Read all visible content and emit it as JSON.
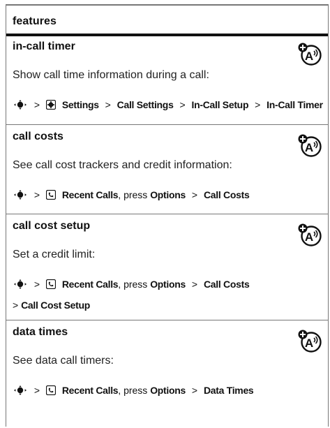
{
  "header": {
    "label": "features"
  },
  "common": {
    "arrow": ">"
  },
  "sections": [
    {
      "title": "in-call timer",
      "description": "Show call time information during a call:",
      "path": {
        "menu": "Settings",
        "step1": "Call Settings",
        "step2": "In-Call Setup",
        "step3": "In-Call Timer"
      }
    },
    {
      "title": "call costs",
      "description": "See call cost trackers and credit information:",
      "path": {
        "menu": "Recent Calls",
        "press": ", press",
        "option": "Options",
        "item": "Call Costs"
      }
    },
    {
      "title": "call cost setup",
      "description": "Set a credit limit:",
      "path": {
        "menu": "Recent Calls",
        "press": ", press",
        "option": "Options",
        "item": "Call Costs",
        "item2": "Call Cost Setup"
      }
    },
    {
      "title": "data times",
      "description": "See data call timers:",
      "path": {
        "menu": "Recent Calls",
        "press": ", press",
        "option": "Options",
        "item": "Data Times"
      }
    }
  ],
  "icons": {
    "network": "network-dependent-feature-icon",
    "nav": "navigation-key-icon",
    "settings": "settings-gear-icon",
    "recent": "recent-calls-icon"
  }
}
